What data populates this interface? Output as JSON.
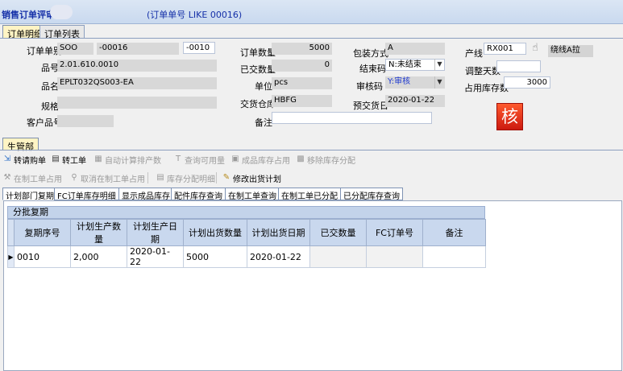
{
  "window": {
    "title": "销售订单评审(",
    "subtitle": "(订单单号 LIKE 00016)"
  },
  "tabs": [
    {
      "label": "订单明细"
    },
    {
      "label": "订单列表"
    }
  ],
  "form": {
    "order_no_label": "订单单别",
    "order_prefix": "SOO",
    "order_no": "-00016",
    "order_seq": "-0010",
    "product_no_label": "品号",
    "product_no": "2.01.610.0010",
    "product_name_label": "品名",
    "product_name": "EPLT032QS003-EA",
    "spec_label": "规格",
    "spec": "",
    "customer_product_label": "客户品号",
    "customer_product": "",
    "order_qty_label": "订单数量",
    "order_qty": "5000",
    "delivered_qty_label": "已交数量",
    "delivered_qty": "0",
    "unit_label": "单位",
    "unit": "pcs",
    "warehouse_label": "交货仓库",
    "warehouse": "HBFG",
    "remark_label": "备注",
    "remark": "",
    "package_label": "包装方式",
    "package": "A",
    "close_code_label": "结束码",
    "close_code": "N:未结束",
    "audit_code_label": "审核码",
    "audit_code": "Y:审核",
    "pre_delivery_label": "预交货日",
    "pre_delivery": "2020-01-22",
    "line_label": "产线",
    "line": "RX001",
    "line_name": "绕线A拉",
    "adjust_days_label": "调整天数",
    "adjust_days": "",
    "stock_used_label": "占用库存数",
    "stock_used": "3000",
    "audit_button": "核"
  },
  "section_tab": "生管部",
  "toolbar1": [
    {
      "label": "转请购单",
      "icon": "doc-transfer-icon"
    },
    {
      "label": "转工单",
      "icon": "workorder-icon"
    },
    {
      "label": "自动计算排产数",
      "icon": "calc-icon"
    },
    {
      "label": "查询可用量",
      "icon": "query-icon"
    },
    {
      "label": "成品库存占用",
      "icon": "stock-icon"
    },
    {
      "label": "移除库存分配",
      "icon": "remove-icon"
    }
  ],
  "toolbar2": [
    {
      "label": "在制工单占用",
      "icon": "wip-icon"
    },
    {
      "label": "取消在制工单占用",
      "icon": "cancel-icon"
    },
    {
      "label": "库存分配明细",
      "icon": "detail-icon"
    },
    {
      "label": "修改出货计划",
      "icon": "edit-icon"
    }
  ],
  "subtabs": [
    "计划部门复期",
    "FC订单库存明细",
    "显示成品库存",
    "配件库存查询",
    "在制工单查询",
    "在制工单已分配",
    "已分配库存查询"
  ],
  "grid": {
    "title": "分批复期",
    "columns": [
      "复期序号",
      "计划生产数量",
      "计划生产日期",
      "计划出货数量",
      "计划出货日期",
      "已交数量",
      "FC订单号",
      "备注"
    ],
    "rows": [
      {
        "seq": "0010",
        "prod_qty": "2,000",
        "prod_date": "2020-01-22",
        "ship_qty": "5000",
        "ship_date": "2020-01-22",
        "delivered": "",
        "fc_no": "",
        "remark": ""
      }
    ]
  },
  "colors": {
    "title": "#1530a8",
    "active_tab": "#fff4c4",
    "grid_header": "#c9d8ee",
    "audit_button": "#e0301a"
  }
}
